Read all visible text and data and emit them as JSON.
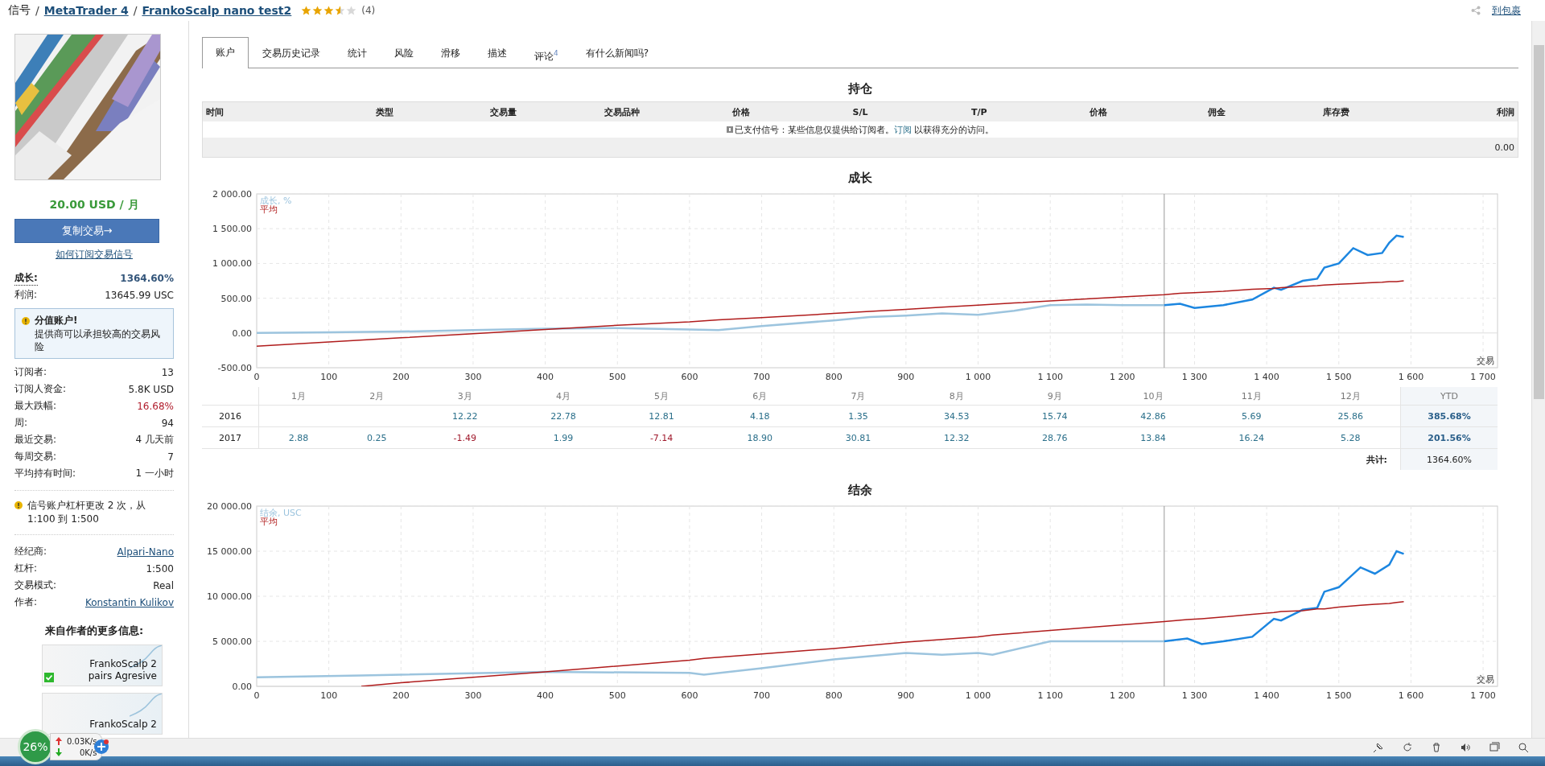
{
  "breadcrumb": {
    "items": [
      {
        "label": "信号",
        "kind": "text"
      },
      {
        "label": "MetaTrader 4",
        "kind": "link"
      },
      {
        "label": "FrankoScalp nano test2",
        "kind": "link"
      }
    ],
    "separator": "/",
    "stars": 3.5,
    "rating_count": "(4)"
  },
  "header_link": "到包裹",
  "sidebar": {
    "price": "20.00 USD / 月",
    "copy_button": "复制交易→",
    "how_link": "如何订阅交易信号",
    "stats": [
      {
        "label": "成长:",
        "value": "1364.60%",
        "kind": "bold"
      },
      {
        "label": "利润:",
        "value": "13645.99 USC",
        "kind": "plain"
      }
    ],
    "tooltip": {
      "title": "分值账户!",
      "text": "提供商可以承担较高的交易风险"
    },
    "stats2": [
      {
        "label": "订阅者:",
        "value": "13",
        "kind": "plain"
      },
      {
        "label": "订阅人资金:",
        "value": "5.8K USD",
        "kind": "plain"
      },
      {
        "label": "最大跌幅:",
        "value": "16.68%",
        "kind": "red"
      },
      {
        "label": "周:",
        "value": "94",
        "kind": "plain"
      },
      {
        "label": "最近交易:",
        "value": "4 几天前",
        "kind": "plain"
      },
      {
        "label": "每周交易:",
        "value": "7",
        "kind": "plain"
      },
      {
        "label": "平均持有时间:",
        "value": "1 一小时",
        "kind": "plain"
      }
    ],
    "notice": "信号账户杠杆更改 2 次，从 1:100 到 1:500",
    "details": [
      {
        "label": "经纪商:",
        "value": "Alpari-Nano",
        "kind": "link"
      },
      {
        "label": "杠杆:",
        "value": "1:500",
        "kind": "plain"
      },
      {
        "label": "交易模式:",
        "value": "Real",
        "kind": "plain"
      },
      {
        "label": "作者:",
        "value": "Konstantin Kulikov",
        "kind": "link"
      }
    ],
    "more_title": "来自作者的更多信息:",
    "products": [
      {
        "name": "FrankoScalp 2",
        "subtitle": "pairs Agresive",
        "checked": true
      },
      {
        "name": "FrankoScalp 2",
        "checked": false
      }
    ]
  },
  "tabs": [
    {
      "label": "账户",
      "selected": true
    },
    {
      "label": "交易历史记录",
      "selected": false
    },
    {
      "label": "统计",
      "selected": false
    },
    {
      "label": "风险",
      "selected": false
    },
    {
      "label": "滑移",
      "selected": false
    },
    {
      "label": "描述",
      "selected": false
    },
    {
      "label": "评论",
      "selected": false,
      "badge": "4"
    },
    {
      "label": "有什么新闻吗?",
      "selected": false
    }
  ],
  "positions": {
    "title": "持仓",
    "columns": [
      "时间",
      "类型",
      "交易量",
      "交易品种",
      "价格",
      "S/L",
      "T/P",
      "价格",
      "佣金",
      "库存费",
      "利润"
    ],
    "notice": "已支付信号：某些信息仅提供给订阅者。",
    "notice_link": "订阅",
    "notice_end": "以获得充分的访问。",
    "total": "0.00"
  },
  "growth": {
    "title": "成长",
    "chart_data": {
      "type": "line",
      "xlabel": "交易",
      "xlim": [
        0,
        1720
      ],
      "ylim": [
        -500,
        2000
      ],
      "grid": true,
      "xticks": [
        0,
        100,
        200,
        300,
        400,
        500,
        600,
        700,
        800,
        900,
        {
          "value": 1000,
          "label": "1 000"
        },
        {
          "value": 1100,
          "label": "1 100"
        },
        {
          "value": 1200,
          "label": "1 200"
        },
        {
          "value": 1300,
          "label": "1 300"
        },
        {
          "value": 1400,
          "label": "1 400"
        },
        {
          "value": 1500,
          "label": "1 500"
        },
        {
          "value": 1600,
          "label": "1 600"
        },
        {
          "value": 1700,
          "label": "1 700"
        }
      ],
      "yticks": [
        {
          "value": -500,
          "label": "-500.00"
        },
        {
          "value": 0,
          "label": "0.00"
        },
        {
          "value": 500,
          "label": "500.00"
        },
        {
          "value": 1000,
          "label": "1 000.00"
        },
        {
          "value": 1500,
          "label": "1 500.00"
        },
        {
          "value": 2000,
          "label": "2 000.00"
        }
      ],
      "x": [
        0,
        100,
        200,
        300,
        400,
        500,
        600,
        640,
        700,
        800,
        850,
        900,
        950,
        1000,
        1050,
        1100,
        1150,
        1200,
        1258,
        1280,
        1300,
        1340,
        1380,
        1410,
        1420,
        1450,
        1470,
        1480,
        1500,
        1520,
        1540,
        1560,
        1570,
        1580,
        1590
      ],
      "series": [
        {
          "name": "成长, %",
          "color": "#9cc4de",
          "values": [
            0,
            10,
            20,
            40,
            60,
            70,
            50,
            40,
            100,
            180,
            230,
            250,
            280,
            260,
            320,
            400,
            410,
            400,
            400,
            null,
            null,
            null,
            null,
            null,
            null,
            null,
            null,
            null,
            null,
            null,
            null,
            null,
            null,
            null,
            null
          ]
        },
        {
          "color": "#1c86e0",
          "values": [
            null,
            null,
            null,
            null,
            null,
            null,
            null,
            null,
            null,
            null,
            null,
            null,
            null,
            null,
            null,
            null,
            null,
            null,
            400,
            420,
            360,
            400,
            480,
            650,
            620,
            750,
            780,
            940,
            1000,
            1220,
            1120,
            1150,
            1300,
            1400,
            1380
          ]
        },
        {
          "name": "平均",
          "color": "#b01c1c",
          "values": [
            -190,
            -130,
            -70,
            -10,
            50,
            110,
            160,
            190,
            220,
            280,
            310,
            340,
            370,
            400,
            430,
            460,
            490,
            520,
            550,
            570,
            580,
            600,
            630,
            640,
            650,
            670,
            680,
            690,
            700,
            710,
            720,
            730,
            740,
            740,
            750
          ]
        }
      ],
      "ref_lines": [
        {
          "axis": "x",
          "value": 1258
        }
      ]
    }
  },
  "monthly": {
    "months": [
      "1月",
      "2月",
      "3月",
      "4月",
      "5月",
      "6月",
      "7月",
      "8月",
      "9月",
      "10月",
      "11月",
      "12月"
    ],
    "ytd_label": "YTD",
    "rows": [
      {
        "year": "2016",
        "cells": [
          null,
          null,
          {
            "value": "12.22",
            "negative": false
          },
          {
            "value": "22.78",
            "negative": false
          },
          {
            "value": "12.81",
            "negative": false
          },
          {
            "value": "4.18",
            "negative": false
          },
          {
            "value": "1.35",
            "negative": false
          },
          {
            "value": "34.53",
            "negative": false
          },
          {
            "value": "15.74",
            "negative": false
          },
          {
            "value": "42.86",
            "negative": false
          },
          {
            "value": "5.69",
            "negative": false
          },
          {
            "value": "25.86",
            "negative": false
          }
        ],
        "ytd": "385.68%"
      },
      {
        "year": "2017",
        "cells": [
          {
            "value": "2.88",
            "negative": false
          },
          {
            "value": "0.25",
            "negative": false
          },
          {
            "value": "-1.49",
            "negative": true
          },
          {
            "value": "1.99",
            "negative": false
          },
          {
            "value": "-7.14",
            "negative": true
          },
          {
            "value": "18.90",
            "negative": false
          },
          {
            "value": "30.81",
            "negative": false
          },
          {
            "value": "12.32",
            "negative": false
          },
          {
            "value": "28.76",
            "negative": false
          },
          {
            "value": "13.84",
            "negative": false
          },
          {
            "value": "16.24",
            "negative": false
          },
          {
            "value": "5.28",
            "negative": false
          }
        ],
        "ytd": "201.56%"
      }
    ],
    "total_label": "共计:",
    "total": "1364.60%"
  },
  "balance": {
    "title": "结余",
    "chart_data": {
      "type": "line",
      "xlabel": "交易",
      "xlim": [
        0,
        1720
      ],
      "ylim": [
        0,
        20000
      ],
      "grid": true,
      "xticks": [
        0,
        100,
        200,
        300,
        400,
        500,
        600,
        700,
        800,
        900,
        {
          "value": 1000,
          "label": "1 000"
        },
        {
          "value": 1100,
          "label": "1 100"
        },
        {
          "value": 1200,
          "label": "1 200"
        },
        {
          "value": 1300,
          "label": "1 300"
        },
        {
          "value": 1400,
          "label": "1 400"
        },
        {
          "value": 1500,
          "label": "1 500"
        },
        {
          "value": 1600,
          "label": "1 600"
        },
        {
          "value": 1700,
          "label": "1 700"
        }
      ],
      "yticks": [
        {
          "value": 0,
          "label": "0.00"
        },
        {
          "value": 5000,
          "label": "5 000.00"
        },
        {
          "value": 10000,
          "label": "10 000.00"
        },
        {
          "value": 15000,
          "label": "15 000.00"
        },
        {
          "value": 20000,
          "label": "20 000.00"
        }
      ],
      "x": [
        0,
        145,
        200,
        400,
        600,
        620,
        700,
        800,
        900,
        950,
        1000,
        1020,
        1100,
        1258,
        1290,
        1310,
        1340,
        1380,
        1410,
        1420,
        1450,
        1470,
        1480,
        1500,
        1530,
        1550,
        1570,
        1580,
        1590
      ],
      "series": [
        {
          "name": "结余, USC",
          "color": "#9cc4de",
          "values": [
            1000,
            1200,
            1300,
            1600,
            1500,
            1300,
            2000,
            3000,
            3700,
            3500,
            3700,
            3500,
            5000,
            5000,
            null,
            null,
            null,
            null,
            null,
            null,
            null,
            null,
            null,
            null,
            null,
            null,
            null,
            null,
            null
          ]
        },
        {
          "color": "#1c86e0",
          "values": [
            null,
            null,
            null,
            null,
            null,
            null,
            null,
            null,
            null,
            null,
            null,
            null,
            null,
            5000,
            5300,
            4700,
            5000,
            5500,
            7500,
            7300,
            8500,
            8700,
            10500,
            11000,
            13200,
            12500,
            13500,
            15000,
            14700
          ]
        },
        {
          "name": "平均",
          "color": "#b01c1c",
          "values": [
            null,
            0,
            400,
            1600,
            2900,
            3100,
            3600,
            4200,
            4900,
            5200,
            5500,
            5700,
            6200,
            7200,
            7400,
            7500,
            7700,
            8000,
            8200,
            8300,
            8400,
            8600,
            8600,
            8800,
            9000,
            9100,
            9200,
            9300,
            9400
          ]
        }
      ],
      "ref_lines": [
        {
          "axis": "x",
          "value": 1258
        }
      ]
    }
  },
  "net_widget": {
    "percent": "26%",
    "upload": "0.03K/s",
    "download": "0K/s"
  }
}
